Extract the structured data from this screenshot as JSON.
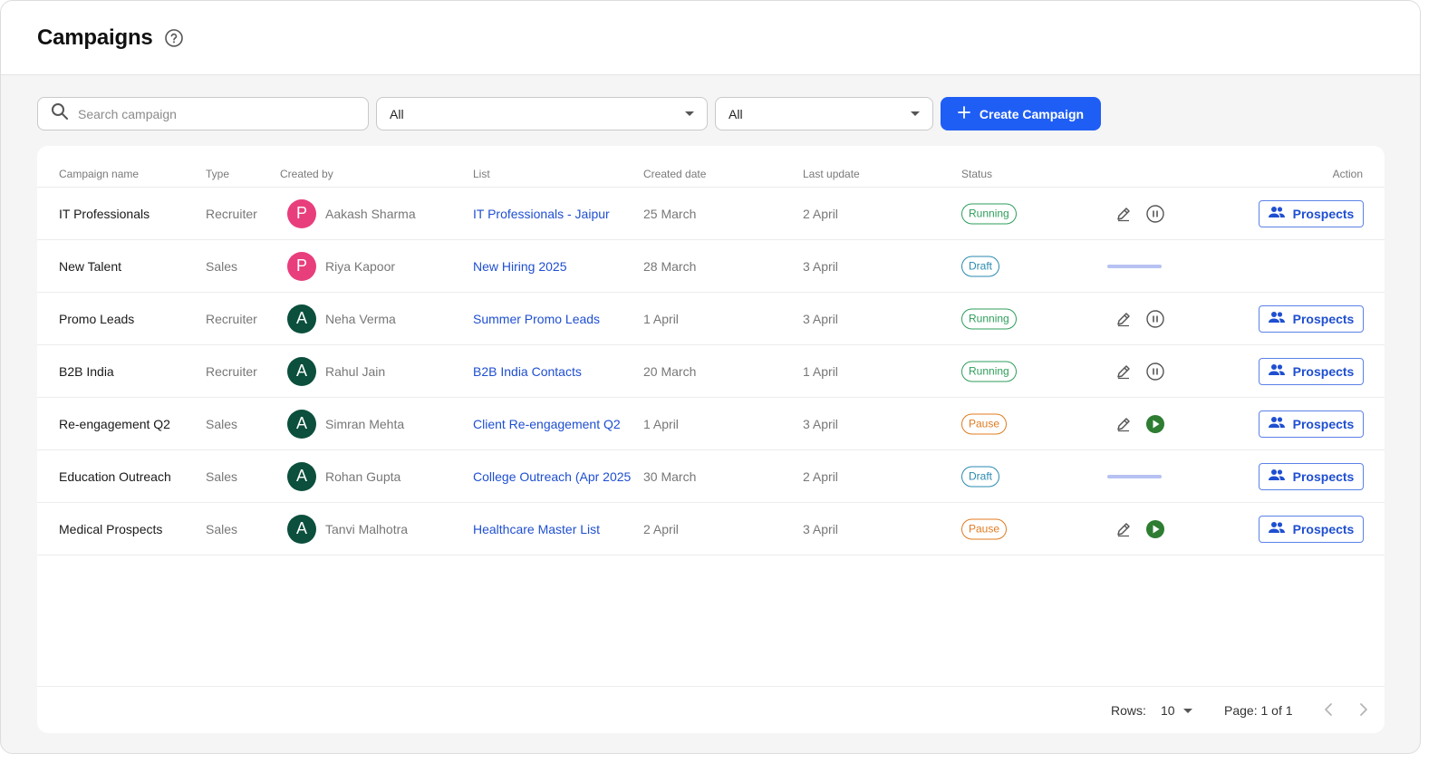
{
  "header": {
    "title": "Campaigns"
  },
  "toolbar": {
    "search_placeholder": "Search campaign",
    "filter_type": "All",
    "filter_status": "All",
    "create_label": "Create Campaign"
  },
  "table": {
    "columns": [
      "Campaign name",
      "Type",
      "Created by",
      "List",
      "Created date",
      "Last update",
      "Status",
      "Action"
    ],
    "rows": [
      {
        "name": "IT Professionals",
        "type": "Recruiter",
        "initial": "P",
        "avatar_color": "#e83e7c",
        "creator": "Aakash Sharma",
        "list": "IT Professionals - Jaipur",
        "created": "25 March",
        "updated": "2 April",
        "status": "Running",
        "action": "Prospects"
      },
      {
        "name": "New Talent",
        "type": "Sales",
        "initial": "P",
        "avatar_color": "#e83e7c",
        "creator": "Riya Kapoor",
        "list": "New Hiring 2025",
        "created": "28 March",
        "updated": "3 April",
        "status": "Draft",
        "action": ""
      },
      {
        "name": "Promo Leads",
        "type": "Recruiter",
        "initial": "A",
        "avatar_color": "#0b4f3c",
        "creator": "Neha Verma",
        "list": "Summer Promo Leads",
        "created": "1 April",
        "updated": "3 April",
        "status": "Running",
        "action": "Prospects"
      },
      {
        "name": "B2B India",
        "type": "Recruiter",
        "initial": "A",
        "avatar_color": "#0b4f3c",
        "creator": "Rahul Jain",
        "list": "B2B India Contacts",
        "created": "20 March",
        "updated": "1 April",
        "status": "Running",
        "action": "Prospects"
      },
      {
        "name": "Re-engagement Q2",
        "type": "Sales",
        "initial": "A",
        "avatar_color": "#0b4f3c",
        "creator": "Simran Mehta",
        "list": "Client Re-engagement Q2",
        "created": "1 April",
        "updated": "3 April",
        "status": "Pause",
        "action": "Prospects"
      },
      {
        "name": "Education Outreach",
        "type": "Sales",
        "initial": "A",
        "avatar_color": "#0b4f3c",
        "creator": "Rohan Gupta",
        "list": "College Outreach (Apr 2025",
        "created": "30 March",
        "updated": "2 April",
        "status": "Draft",
        "action": "Prospects"
      },
      {
        "name": "Medical Prospects",
        "type": "Sales",
        "initial": "A",
        "avatar_color": "#0b4f3c",
        "creator": "Tanvi Malhotra",
        "list": "Healthcare Master List",
        "created": "2 April",
        "updated": "3 April",
        "status": "Pause",
        "action": "Prospects"
      }
    ]
  },
  "status_colors": {
    "Running": "#2e9e5b",
    "Draft": "#2a8ab0",
    "Pause": "#e07b1f"
  },
  "footer": {
    "rows_label": "Rows:",
    "rows_value": "10",
    "page_label": "Page: 1 of 1"
  },
  "colors": {
    "accent": "#1f5ef5",
    "link": "#1f4fd1"
  }
}
